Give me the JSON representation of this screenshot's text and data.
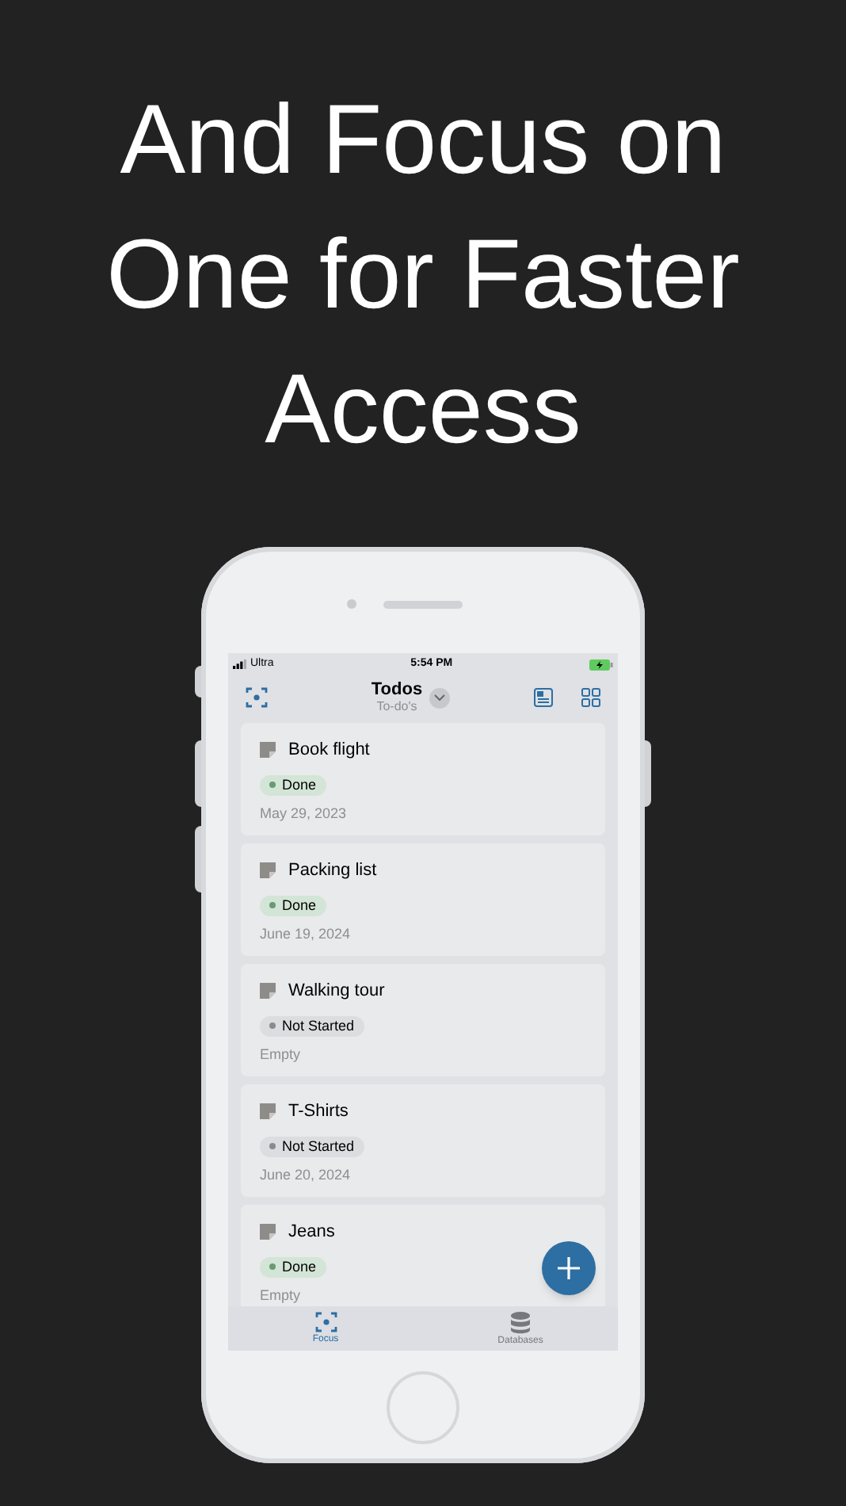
{
  "headline": "And Focus on One for Faster Access",
  "status_bar": {
    "carrier": "Ultra",
    "time": "5:54 PM"
  },
  "nav": {
    "title": "Todos",
    "subtitle": "To-do's"
  },
  "cards": [
    {
      "title": "Book flight",
      "status": {
        "label": "Done",
        "kind": "done"
      },
      "date": "May 29, 2023"
    },
    {
      "title": "Packing list",
      "status": {
        "label": "Done",
        "kind": "done"
      },
      "date": "June 19, 2024"
    },
    {
      "title": "Walking tour",
      "status": {
        "label": "Not Started",
        "kind": "not_started"
      },
      "date": "Empty"
    },
    {
      "title": "T-Shirts",
      "status": {
        "label": "Not Started",
        "kind": "not_started"
      },
      "date": "June 20, 2024"
    },
    {
      "title": "Jeans",
      "status": {
        "label": "Done",
        "kind": "done"
      },
      "date": "Empty"
    }
  ],
  "tab_bar": [
    {
      "label": "Focus",
      "kind": "focus",
      "selected": true
    },
    {
      "label": "Databases",
      "kind": "databases",
      "selected": false
    }
  ]
}
